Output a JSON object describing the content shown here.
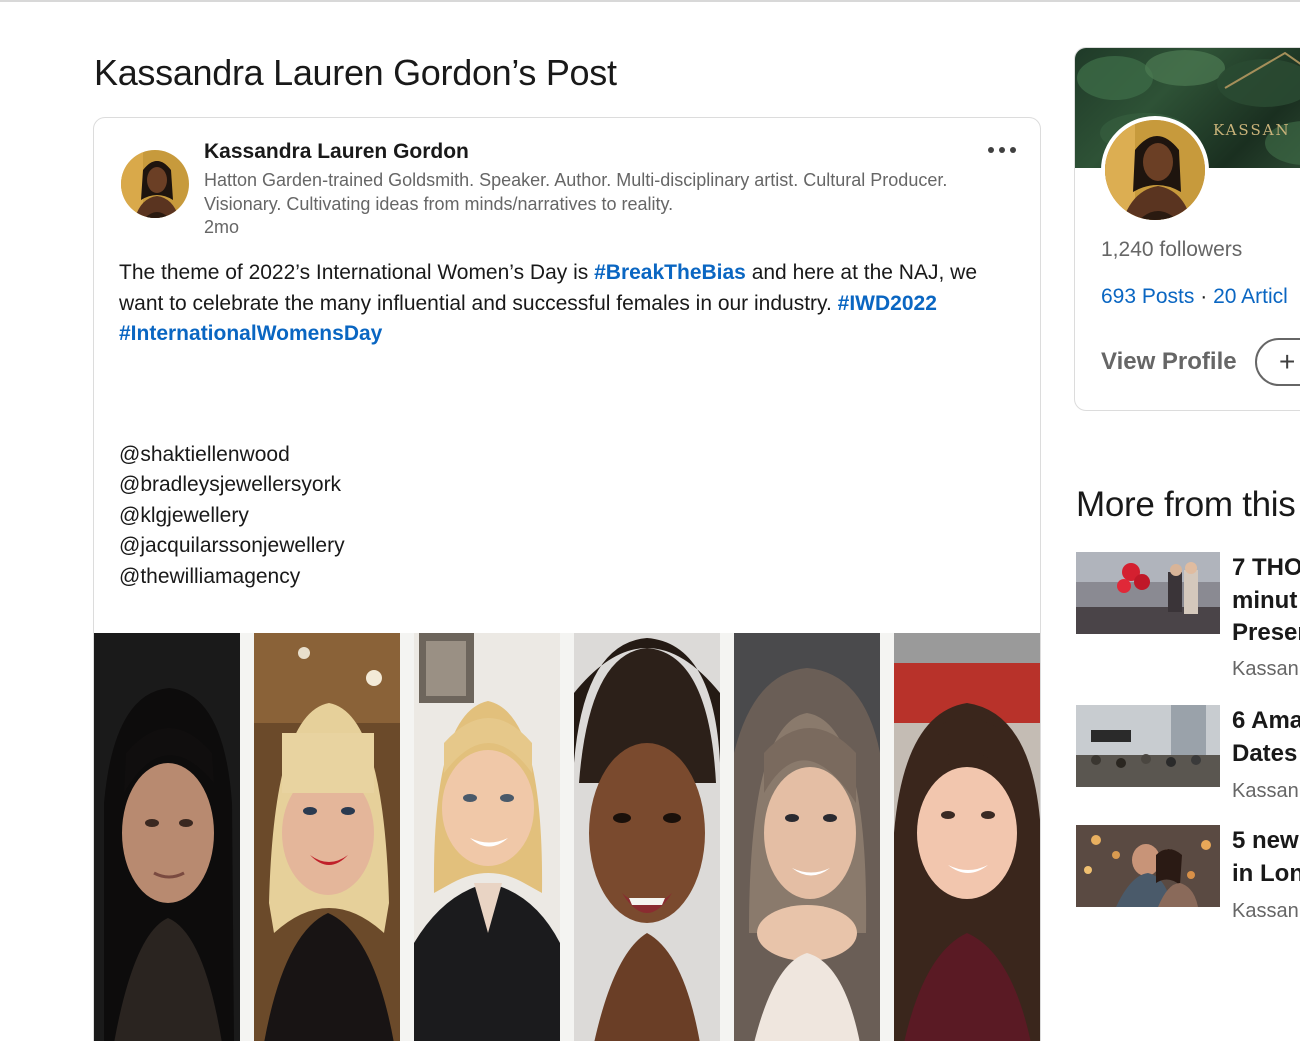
{
  "page": {
    "title": "Kassandra Lauren Gordon’s Post"
  },
  "post": {
    "author_name": "Kassandra Lauren Gordon",
    "author_headline": "Hatton Garden-trained Goldsmith. Speaker. Author. Multi-disciplinary artist. Cultural Producer. Visionary. Cultivating ideas from minds/narratives to reality.",
    "time": "2mo",
    "body_part1": "The theme of 2022’s International Women’s Day is ",
    "hashtag_1": "#BreakTheBias",
    "body_part2": " and here at the NAJ, we want to celebrate the many influential and successful females in our industry. ",
    "hashtag_2": "#IWD2022",
    "hashtag_3": "#InternationalWomensDay",
    "mentions": [
      "@shaktiellenwood",
      "@bradleysjewellersyork",
      "@klgjewellery",
      "@jacquilarssonjewellery",
      "@thewilliamagency"
    ]
  },
  "profile": {
    "banner_text": "KASSAN",
    "followers": "1,240 followers",
    "posts": "693 Posts",
    "separator": "·",
    "articles": "20 Articl",
    "view_profile": "View Profile",
    "follow_symbol": "+"
  },
  "more_from": {
    "heading": "More from this",
    "articles": [
      {
        "title_line1": "7 THO",
        "title_line2": "minut",
        "title_line3": "Preser",
        "author": "Kassan"
      },
      {
        "title_line1": "6 Ama",
        "title_line2": "Dates",
        "author": "Kassan"
      },
      {
        "title_line1": "5 new",
        "title_line2": "in Lon",
        "author": "Kassan"
      }
    ]
  },
  "colors": {
    "link": "#0a66c2",
    "text_primary": "#191919",
    "text_secondary": "#666666",
    "border": "#dcdcdc"
  },
  "icons": {
    "more": "ellipsis-icon",
    "follow": "plus-icon"
  }
}
